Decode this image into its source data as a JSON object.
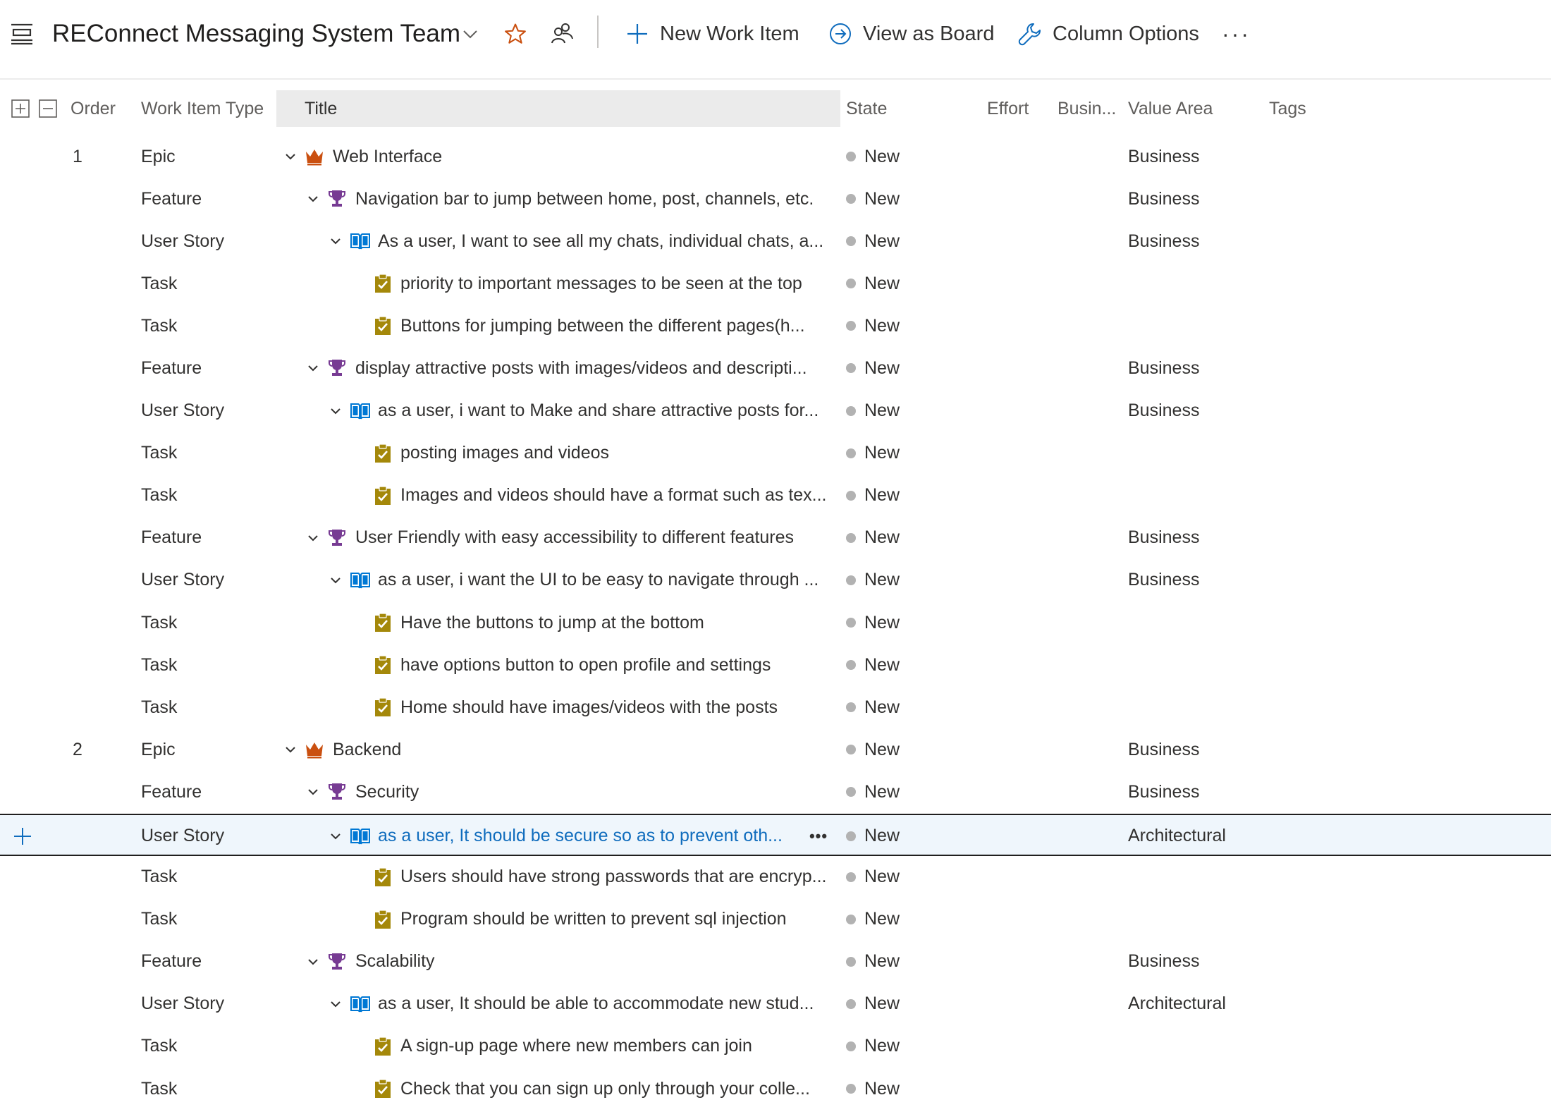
{
  "header": {
    "team_name": "REConnect Messaging System Team",
    "new_work_item": "New Work Item",
    "view_as_board": "View as Board",
    "column_options": "Column Options",
    "more": "···"
  },
  "columns": {
    "order": "Order",
    "work_item_type": "Work Item Type",
    "title": "Title",
    "state": "State",
    "effort": "Effort",
    "business": "Busin...",
    "value_area": "Value Area",
    "tags": "Tags"
  },
  "colors": {
    "epic": "#ca5010",
    "feature": "#773b93",
    "user_story": "#0078d4",
    "task": "#a4880a",
    "state_new": "#b2b2b2",
    "accent": "#0f6cbd"
  },
  "row_more": "•••",
  "rows": [
    {
      "order": "1",
      "type": "Epic",
      "level": 0,
      "icon": "crown-icon",
      "expandable": true,
      "title": "Web Interface",
      "state": "New",
      "value_area": "Business"
    },
    {
      "order": "",
      "type": "Feature",
      "level": 1,
      "icon": "trophy-icon",
      "expandable": true,
      "title": "Navigation bar to jump between home, post, channels, etc.",
      "state": "New",
      "value_area": "Business"
    },
    {
      "order": "",
      "type": "User Story",
      "level": 2,
      "icon": "book-icon",
      "expandable": true,
      "title": "As a user, I want to see all my chats, individual chats, a...",
      "state": "New",
      "value_area": "Business"
    },
    {
      "order": "",
      "type": "Task",
      "level": 3,
      "icon": "clipboard-check-icon",
      "expandable": false,
      "title": "priority to important messages to be seen at the top",
      "state": "New",
      "value_area": ""
    },
    {
      "order": "",
      "type": "Task",
      "level": 3,
      "icon": "clipboard-check-icon",
      "expandable": false,
      "title": "Buttons for jumping between the different pages(h...",
      "state": "New",
      "value_area": ""
    },
    {
      "order": "",
      "type": "Feature",
      "level": 1,
      "icon": "trophy-icon",
      "expandable": true,
      "title": "display attractive posts with images/videos and descripti...",
      "state": "New",
      "value_area": "Business"
    },
    {
      "order": "",
      "type": "User Story",
      "level": 2,
      "icon": "book-icon",
      "expandable": true,
      "title": "as a user, i want to Make and share attractive posts for...",
      "state": "New",
      "value_area": "Business"
    },
    {
      "order": "",
      "type": "Task",
      "level": 3,
      "icon": "clipboard-check-icon",
      "expandable": false,
      "title": "posting images and videos",
      "state": "New",
      "value_area": ""
    },
    {
      "order": "",
      "type": "Task",
      "level": 3,
      "icon": "clipboard-check-icon",
      "expandable": false,
      "title": "Images and videos should have a format such as tex...",
      "state": "New",
      "value_area": ""
    },
    {
      "order": "",
      "type": "Feature",
      "level": 1,
      "icon": "trophy-icon",
      "expandable": true,
      "title": "User Friendly with easy accessibility to different features",
      "state": "New",
      "value_area": "Business"
    },
    {
      "order": "",
      "type": "User Story",
      "level": 2,
      "icon": "book-icon",
      "expandable": true,
      "title": "as a user, i want the UI to be easy to navigate through ...",
      "state": "New",
      "value_area": "Business"
    },
    {
      "order": "",
      "type": "Task",
      "level": 3,
      "icon": "clipboard-check-icon",
      "expandable": false,
      "title": "Have the buttons to jump at the bottom",
      "state": "New",
      "value_area": ""
    },
    {
      "order": "",
      "type": "Task",
      "level": 3,
      "icon": "clipboard-check-icon",
      "expandable": false,
      "title": "have options button to open profile and settings",
      "state": "New",
      "value_area": ""
    },
    {
      "order": "",
      "type": "Task",
      "level": 3,
      "icon": "clipboard-check-icon",
      "expandable": false,
      "title": "Home should have images/videos with the posts",
      "state": "New",
      "value_area": ""
    },
    {
      "order": "2",
      "type": "Epic",
      "level": 0,
      "icon": "crown-icon",
      "expandable": true,
      "title": "Backend",
      "state": "New",
      "value_area": "Business"
    },
    {
      "order": "",
      "type": "Feature",
      "level": 1,
      "icon": "trophy-icon",
      "expandable": true,
      "title": "Security",
      "state": "New",
      "value_area": "Business"
    },
    {
      "order": "",
      "type": "User Story",
      "level": 2,
      "icon": "book-icon",
      "expandable": true,
      "selected": true,
      "title": "as a user, It should be secure so as to prevent oth...",
      "state": "New",
      "value_area": "Architectural"
    },
    {
      "order": "",
      "type": "Task",
      "level": 3,
      "icon": "clipboard-check-icon",
      "expandable": false,
      "title": "Users should have strong passwords that are encryp...",
      "state": "New",
      "value_area": ""
    },
    {
      "order": "",
      "type": "Task",
      "level": 3,
      "icon": "clipboard-check-icon",
      "expandable": false,
      "title": "Program should be written to prevent sql injection",
      "state": "New",
      "value_area": ""
    },
    {
      "order": "",
      "type": "Feature",
      "level": 1,
      "icon": "trophy-icon",
      "expandable": true,
      "title": "Scalability",
      "state": "New",
      "value_area": "Business"
    },
    {
      "order": "",
      "type": "User Story",
      "level": 2,
      "icon": "book-icon",
      "expandable": true,
      "title": "as a user, It should be able to accommodate new stud...",
      "state": "New",
      "value_area": "Architectural"
    },
    {
      "order": "",
      "type": "Task",
      "level": 3,
      "icon": "clipboard-check-icon",
      "expandable": false,
      "title": "A sign-up page where new members can join",
      "state": "New",
      "value_area": ""
    },
    {
      "order": "",
      "type": "Task",
      "level": 3,
      "icon": "clipboard-check-icon",
      "expandable": false,
      "title": "Check that you can sign up only through your colle...",
      "state": "New",
      "value_area": ""
    }
  ]
}
